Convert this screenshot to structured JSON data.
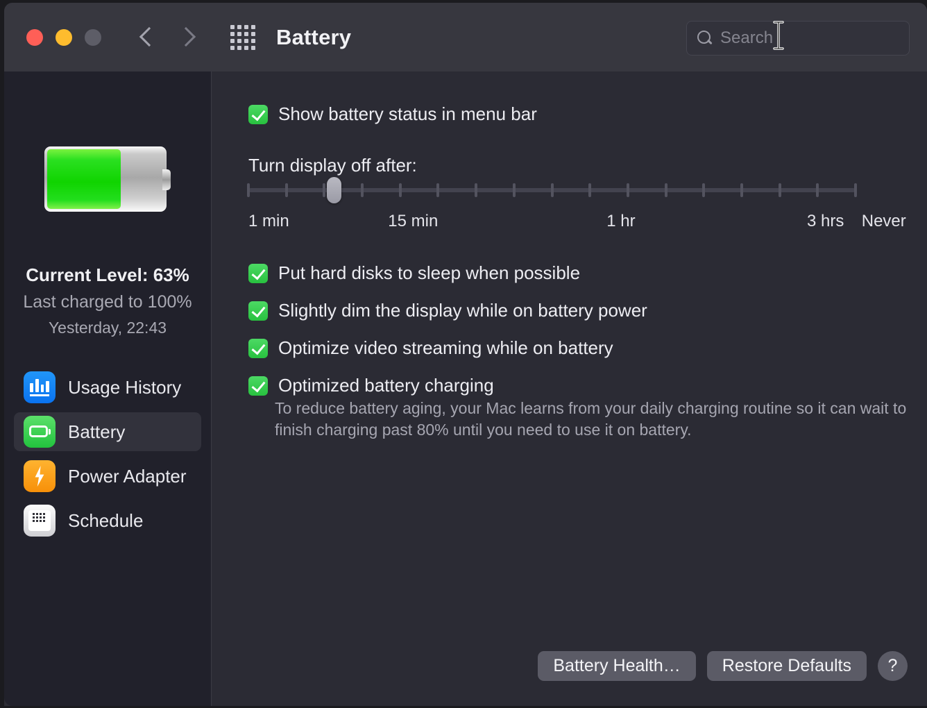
{
  "window": {
    "title": "Battery",
    "traffic_lights": [
      "close-red",
      "minimize-yellow",
      "zoom-disabled"
    ],
    "nav_back": "back-chevron",
    "nav_forward": "forward-chevron",
    "show_all": "grid-icon"
  },
  "search": {
    "placeholder": "Search",
    "value": "",
    "icon": "search-icon",
    "cursor": "i-beam-cursor"
  },
  "sidebar": {
    "battery_icon": "battery-graphic",
    "battery_fill_percent": 63,
    "current_level": "Current Level: 63%",
    "last_charged": "Last charged to 100%",
    "charged_time": "Yesterday, 22:43",
    "items": [
      {
        "label": "Usage History",
        "icon": "chart-bar-icon",
        "selected": false
      },
      {
        "label": "Battery",
        "icon": "battery-icon",
        "selected": true
      },
      {
        "label": "Power Adapter",
        "icon": "lightning-bolt-icon",
        "selected": false
      },
      {
        "label": "Schedule",
        "icon": "calendar-icon",
        "selected": false
      }
    ]
  },
  "main": {
    "menubar_checkbox": {
      "label": "Show battery status in menu bar",
      "checked": true
    },
    "slider": {
      "title": "Turn display off after:",
      "value_percent": 14,
      "tick_count": 17,
      "labels": [
        {
          "text": "1 min",
          "pos_percent": 0
        },
        {
          "text": "15 min",
          "pos_percent": 23
        },
        {
          "text": "1 hr",
          "pos_percent": 59
        },
        {
          "text": "3 hrs",
          "pos_percent": 92
        },
        {
          "text": "Never",
          "pos_percent": 101
        }
      ]
    },
    "checkboxes": [
      {
        "label": "Put hard disks to sleep when possible",
        "checked": true
      },
      {
        "label": "Slightly dim the display while on battery power",
        "checked": true
      },
      {
        "label": "Optimize video streaming while on battery",
        "checked": true
      },
      {
        "label": "Optimized battery charging",
        "checked": true
      }
    ],
    "optimized_description": "To reduce battery aging, your Mac learns from your daily charging routine so it can wait to finish charging past 80% until you need to use it on battery."
  },
  "footer": {
    "battery_health_label": "Battery Health…",
    "restore_defaults_label": "Restore Defaults",
    "help_label": "?"
  },
  "colors": {
    "accent_green": "#28c13f",
    "window_bg": "#2b2b34",
    "sidebar_bg": "#21212b",
    "titlebar_bg": "#37373f"
  }
}
